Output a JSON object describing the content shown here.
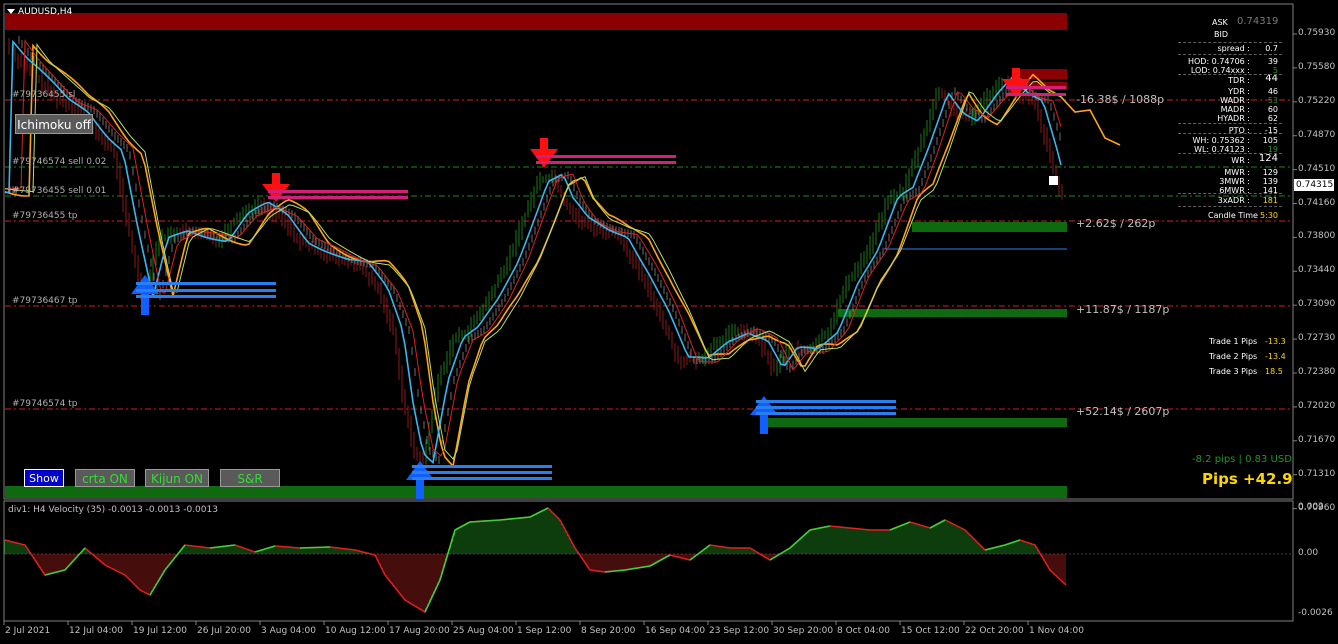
{
  "chart": {
    "title": "AUDUSD,H4",
    "subwindow_title": "div1: H4 Velocity (35) -0.0013 -0.0013 -0.0013",
    "current_price": "0.74315"
  },
  "price_axis": [
    "0.75930",
    "0.75580",
    "0.75220",
    "0.74870",
    "0.74510",
    "0.74160",
    "0.73800",
    "0.73440",
    "0.73090",
    "0.72730",
    "0.72380",
    "0.72020",
    "0.71670",
    "0.71310",
    "0.70960"
  ],
  "sub_axis": [
    "0.002",
    "0.00",
    "-0.0026"
  ],
  "time_axis": [
    "2 Jul 2021",
    "12 Jul 04:00",
    "19 Jul 12:00",
    "26 Jul 20:00",
    "3 Aug 04:00",
    "10 Aug 12:00",
    "17 Aug 20:00",
    "25 Aug 04:00",
    "1 Sep 12:00",
    "8 Sep 20:00",
    "16 Sep 04:00",
    "23 Sep 12:00",
    "30 Sep 20:00",
    "8 Oct 04:00",
    "15 Oct 12:00",
    "22 Oct 20:00",
    "1 Nov 04:00"
  ],
  "order_labels": {
    "o1": "#79736455 sl",
    "o2": "#79746574 sell 0.02",
    "o3": "#79736455 sell 0.01",
    "o4": "#79736455 tp",
    "o5": "#79736467 tp",
    "o6": "#79746574 tp"
  },
  "profit_labels": {
    "p1": "-16.38$ / 1088p",
    "p2": "+2.62$ / 262p",
    "p3": "+11.87$ / 1187p",
    "p4": "+52.14$ / 2607p"
  },
  "buttons": {
    "ichimoku": "Ichimoku off",
    "show": "Show",
    "crta": "crta ON",
    "kijun": "Kijun ON",
    "sr": "S&R"
  },
  "panel": {
    "ask_label": "ASK",
    "ask_value": "0.74319",
    "bid_label": "BID",
    "spread_label": "spread :",
    "spread_value": "0.7",
    "hod_label": "HOD: 0.74706 :",
    "hod_value": "39",
    "lod_label": "LOD: 0.74xxx :",
    "lod_value": "5",
    "tdr_label": "TDR :",
    "tdr_value": "44",
    "ydr_label": "YDR :",
    "ydr_value": "46",
    "wadr_label": "WADR :",
    "wadr_value": "53",
    "madr_label": "MADR :",
    "madr_value": "60",
    "hyadr_label": "HYADR :",
    "hyadr_value": "62",
    "pto_label": "PTO :",
    "pto_value": "-15",
    "wh_label": "WH: 0.75362 :",
    "wh_value": "105",
    "wl_label": "WL: 0.74123 :",
    "wl_value": "19",
    "wr_label": "WR :",
    "wr_value": "124",
    "mwr_label": "MWR :",
    "mwr_value": "129",
    "mwr3_label": "3MWR :",
    "mwr3_value": "139",
    "mwr6_label": "6MWR :",
    "mwr6_value": "141",
    "adr3_label": "3xADR :",
    "adr3_value": "181",
    "candle_label": "Candle Time",
    "candle_value": "5:30"
  },
  "trades": {
    "t1_label": "Trade 1 Pips",
    "t1_value": "-13.3",
    "t2_label": "Trade 2 Pips",
    "t2_value": "-13.4",
    "t3_label": "Trade 3 Pips",
    "t3_value": "18.5"
  },
  "summary": {
    "small": "-8.2 pips | 0.83 USD",
    "big": "Pips +42.9"
  },
  "colors": {
    "bull": "#1a7a1a",
    "bear": "#8b1a1a",
    "orange": "#ffa31a",
    "cyan": "#35b8f0",
    "red_line": "#e02020",
    "green_line": "#3cd03c",
    "zone_red": "#8b0000",
    "zone_green": "#0f6a0f",
    "magenta": "#d0207a",
    "blue": "#2a7ff0",
    "yellow": "#ffd700"
  }
}
